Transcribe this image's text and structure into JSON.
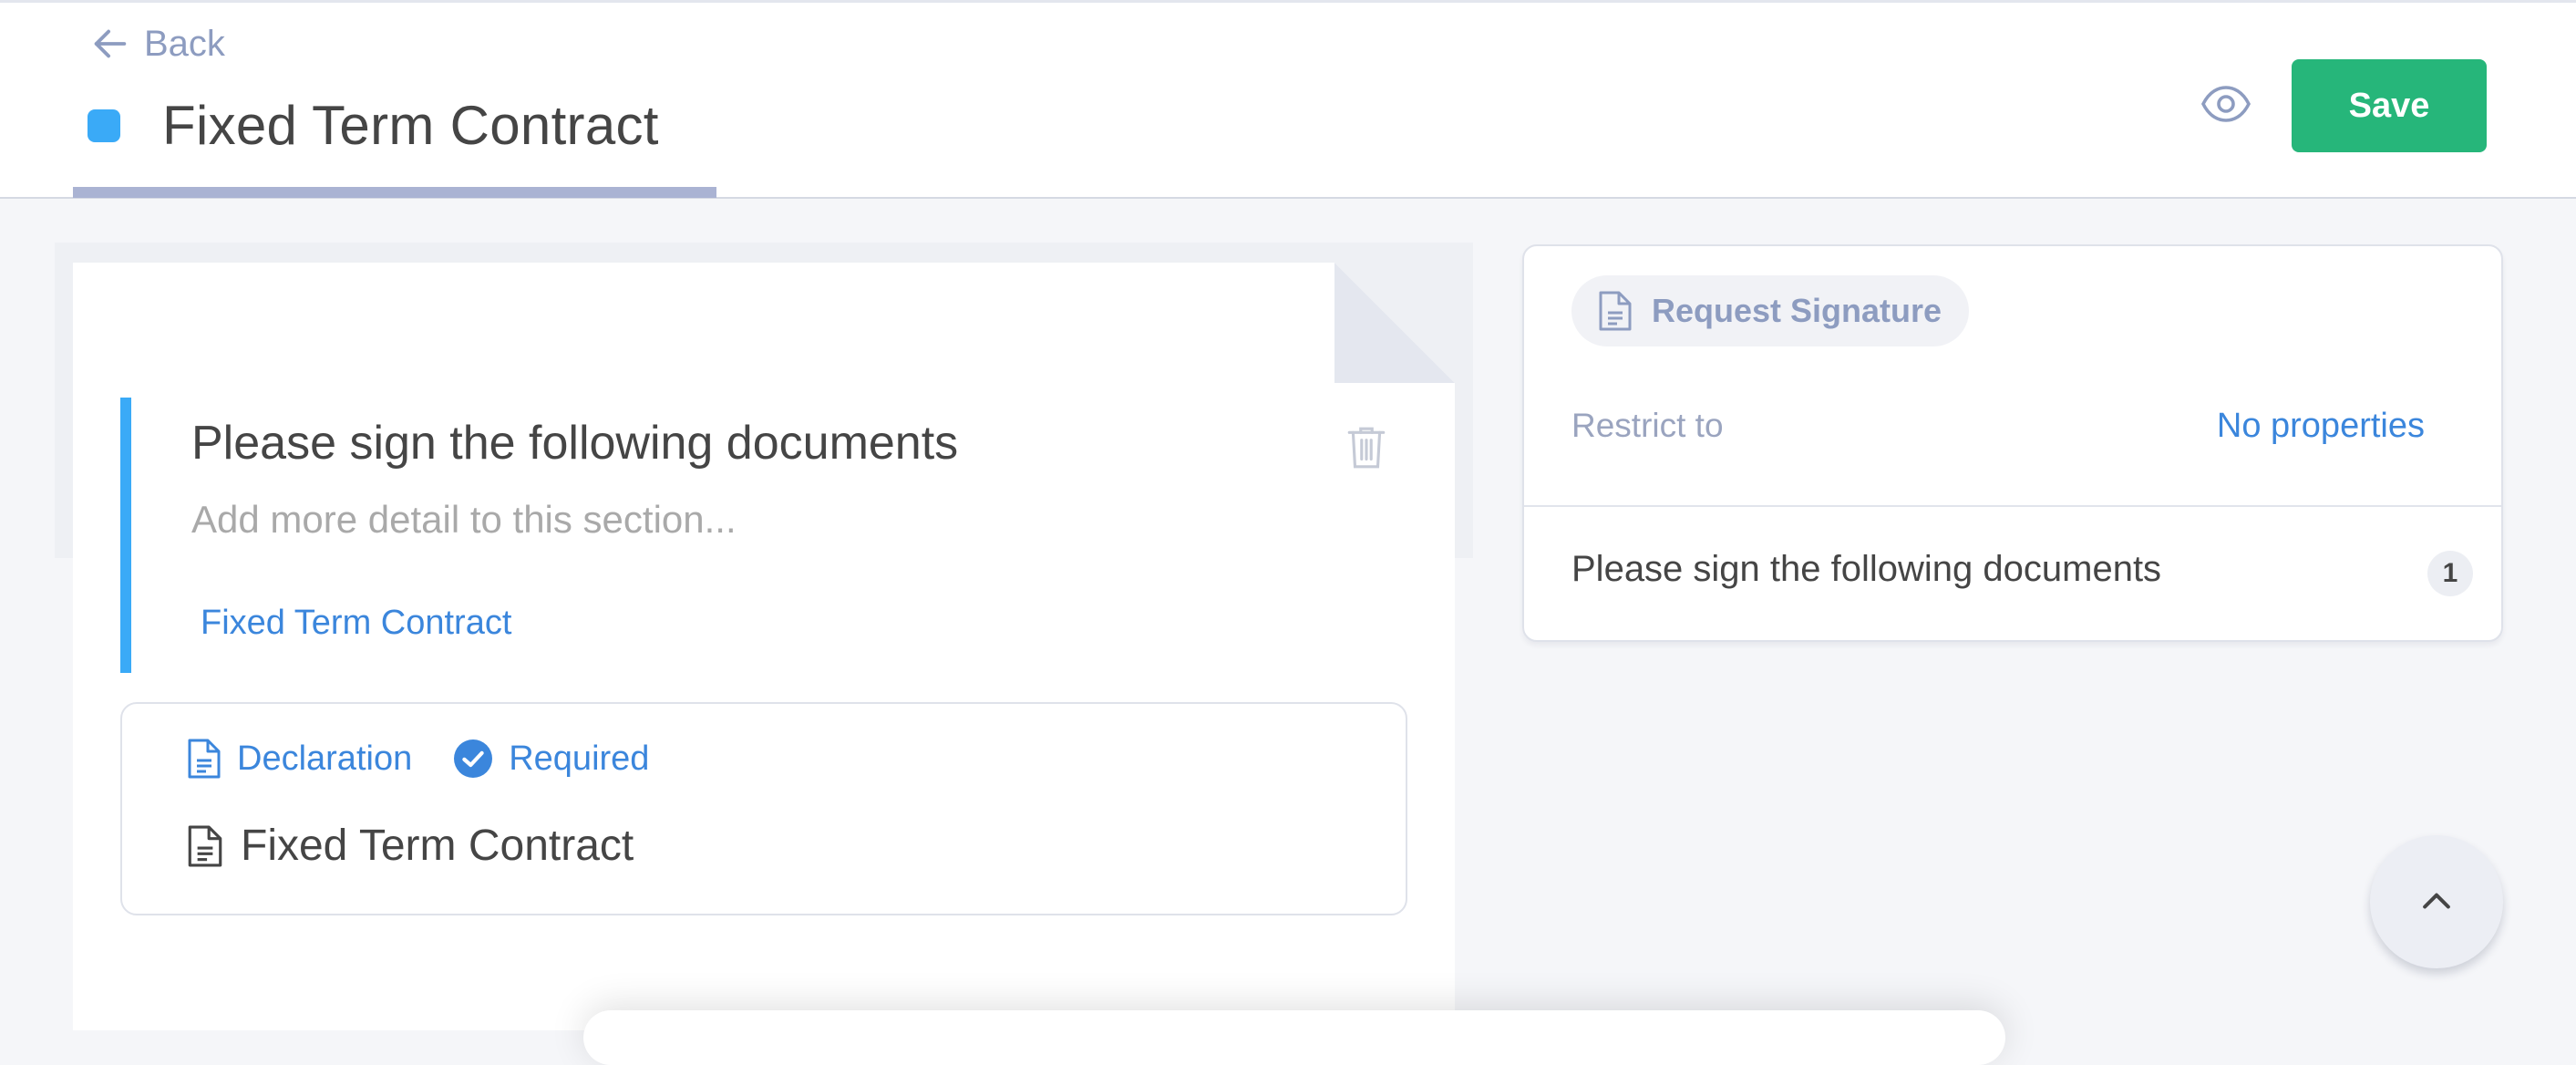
{
  "header": {
    "back_label": "Back",
    "title": "Fixed Term Contract",
    "title_dot_color": "#3aaaf7",
    "save_label": "Save",
    "save_color": "#26b67a"
  },
  "section": {
    "title": "Please sign the following documents",
    "detail_placeholder": "Add more detail to this section...",
    "link": "Fixed Term Contract",
    "accent_color": "#3aaaf7"
  },
  "declaration": {
    "type_label": "Declaration",
    "required_label": "Required",
    "file_name": "Fixed Term Contract"
  },
  "side_panel": {
    "request_label": "Request Signature",
    "restrict_label": "Restrict to",
    "restrict_value": "No properties",
    "section_row": "Please sign the following documents",
    "section_count": "1"
  },
  "icons": {
    "back": "arrow-left-icon",
    "preview": "eye-icon",
    "delete": "trash-icon",
    "document": "document-icon",
    "required": "check-circle-icon",
    "scroll_top": "chevron-up-icon"
  }
}
